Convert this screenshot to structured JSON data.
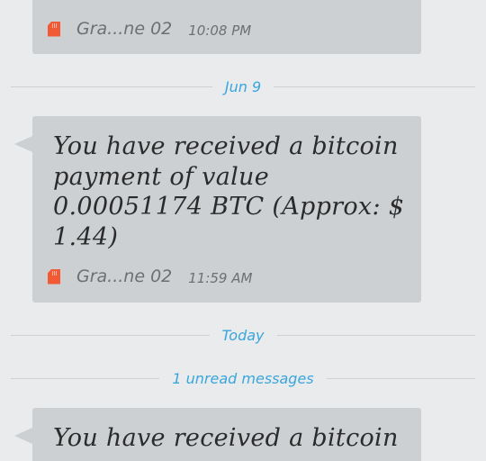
{
  "conversation": {
    "messages": [
      {
        "text": "",
        "sender": "Gra...ne 02",
        "time": "10:08 PM"
      },
      {
        "text": "You have received a bitcoin payment of value 0.00051174 BTC (Approx: $ 1.44)",
        "sender": "Gra...ne 02",
        "time": "11:59 AM"
      },
      {
        "text": "You have received a bitcoin",
        "sender": "",
        "time": ""
      }
    ],
    "dividers": {
      "date_jun9": "Jun 9",
      "today": "Today",
      "unread": "1 unread messages"
    }
  },
  "colors": {
    "background": "#eaebec",
    "bubble": "#cdd0d3",
    "accent": "#3aa6dc",
    "sim_icon": "#f25a35",
    "meta_text": "#6d6f72"
  },
  "icons": {
    "sim": "sim-card-icon"
  }
}
